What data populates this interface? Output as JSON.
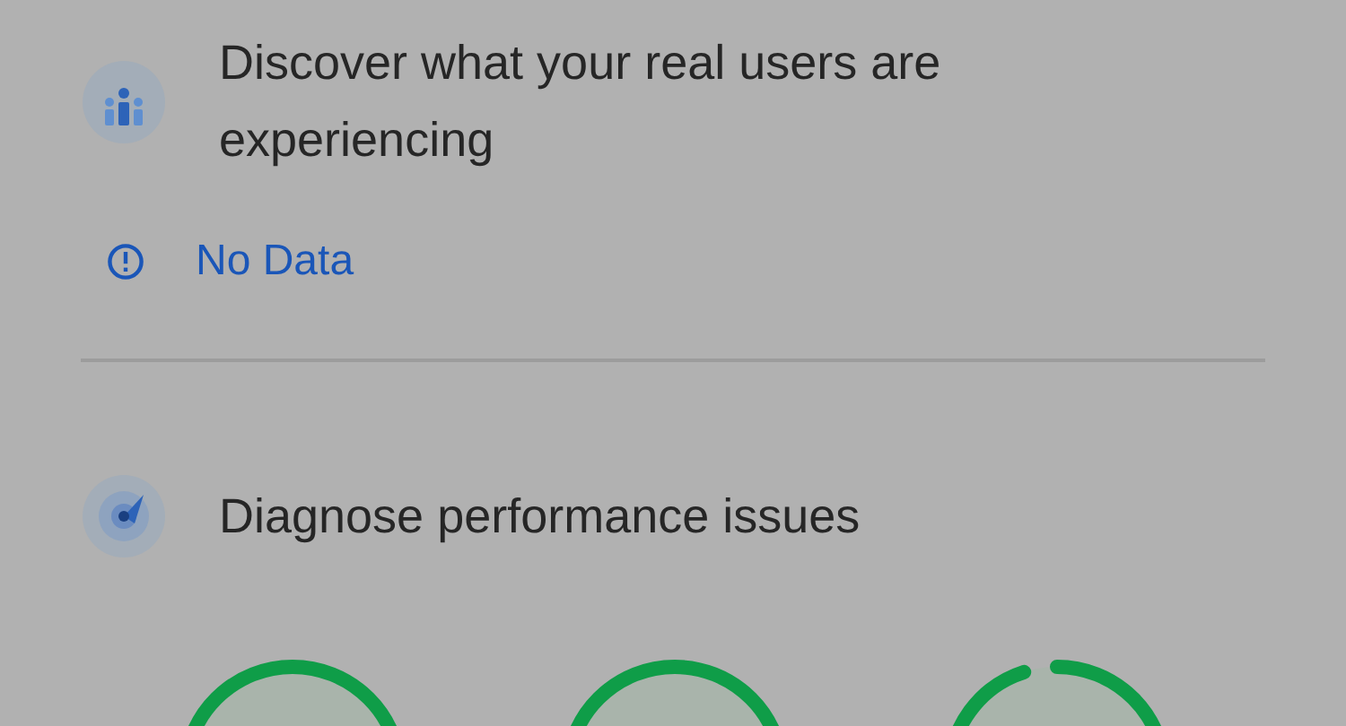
{
  "sections": [
    {
      "kind": "field",
      "title": "Discover what your real users are experiencing",
      "status": {
        "text": "No Data"
      }
    },
    {
      "kind": "lab",
      "title": "Diagnose performance issues",
      "gauges": true
    }
  ]
}
